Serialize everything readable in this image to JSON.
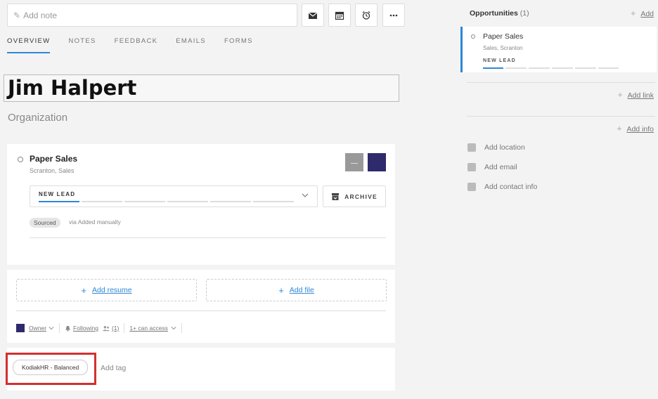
{
  "note": {
    "placeholder": "Add note"
  },
  "toolbar": [
    "mail-icon",
    "calendar-icon",
    "alarm-icon",
    "more-icon"
  ],
  "tabs": [
    {
      "label": "OVERVIEW",
      "active": true
    },
    {
      "label": "NOTES"
    },
    {
      "label": "FEEDBACK"
    },
    {
      "label": "EMAILS"
    },
    {
      "label": "FORMS"
    }
  ],
  "profile": {
    "name": "Jim Halpert",
    "organization_placeholder": "Organization"
  },
  "opportunity": {
    "title": "Paper Sales",
    "subtitle": "Scranton, Sales",
    "stage": "NEW LEAD",
    "archive_label": "ARCHIVE",
    "source_pill": "Sourced",
    "source_via": "via Added manually",
    "colors": {
      "swatch_gray": "#999999",
      "swatch_navy": "#2e2a6b"
    }
  },
  "files": {
    "add_resume": "Add resume",
    "add_file": "Add file"
  },
  "access": {
    "owner": "Owner",
    "following": "Following",
    "following_count": "(1)",
    "can_access": "1+ can access"
  },
  "tags": {
    "items": [
      "KodiakHR - Balanced"
    ],
    "add_tag": "Add tag"
  },
  "sidebar": {
    "opportunities_label": "Opportunities",
    "opportunities_count": "(1)",
    "add": "Add",
    "opp": {
      "title": "Paper Sales",
      "subtitle": "Sales, Scranton",
      "stage": "NEW LEAD"
    },
    "add_link": "Add link",
    "add_info": "Add info",
    "contacts": [
      "Add location",
      "Add email",
      "Add contact info"
    ]
  },
  "accent_color": "#2e88d6",
  "highlight_color": "#d32f2f"
}
